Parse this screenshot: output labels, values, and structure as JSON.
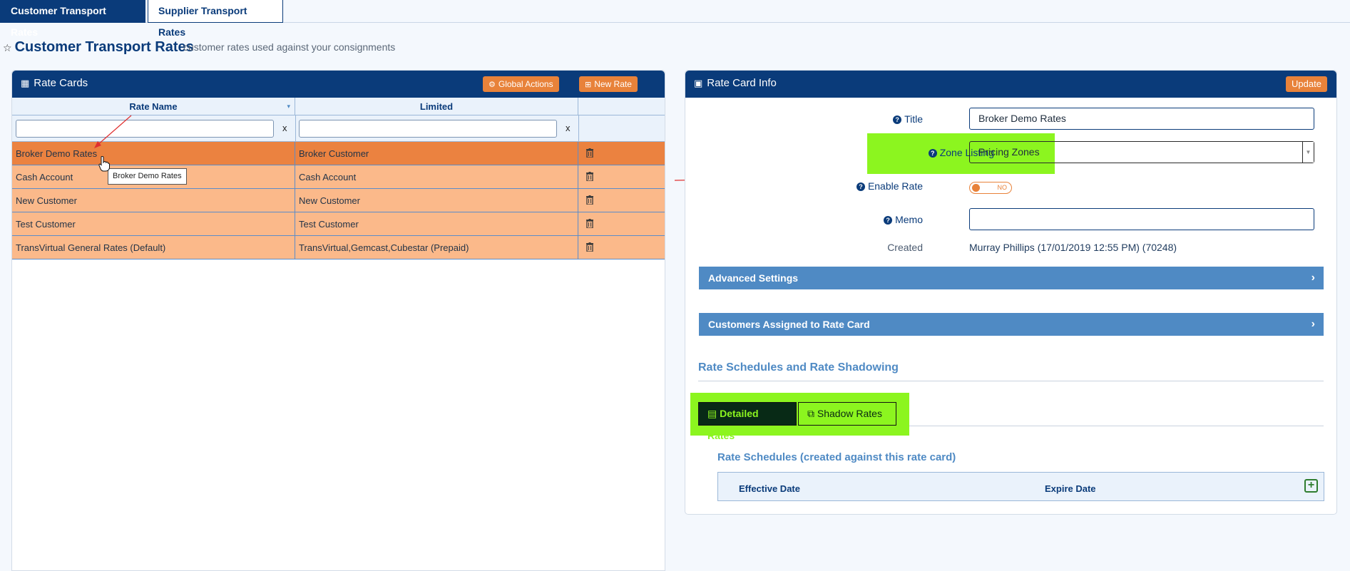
{
  "top_tabs": [
    {
      "label": "Customer Transport Rates",
      "active": true
    },
    {
      "label": "Supplier Transport Rates",
      "active": false
    }
  ],
  "page": {
    "title": "Customer Transport Rates",
    "subtitle": "customer rates used against your consignments"
  },
  "rate_cards": {
    "title": "Rate Cards",
    "global_actions_label": "Global Actions",
    "new_rate_label": "New Rate",
    "columns": [
      "Rate Name",
      "Limited"
    ],
    "filter_clear": "x",
    "rows": [
      {
        "name": "Broker Demo Rates",
        "limited": "Broker Customer",
        "selected": true
      },
      {
        "name": "Cash Account",
        "limited": "Cash Account",
        "selected": false
      },
      {
        "name": "New Customer",
        "limited": "New Customer",
        "selected": false
      },
      {
        "name": "Test Customer",
        "limited": "Test Customer",
        "selected": false
      },
      {
        "name": "TransVirtual General Rates (Default)",
        "limited": "TransVirtual,Gemcast,Cubestar (Prepaid)",
        "selected": false
      }
    ],
    "tooltip": "Broker Demo Rates"
  },
  "rate_card_info": {
    "title": "Rate Card Info",
    "update_label": "Update",
    "title_label": "Title",
    "title_value": "Broker Demo Rates",
    "zone_listing_label": "Zone Listing",
    "zone_listing_value": "Pricing Zones",
    "enable_rate_label": "Enable Rate",
    "enable_rate_state": "NO",
    "memo_label": "Memo",
    "memo_value": "",
    "created_label": "Created",
    "created_value": "Murray Phillips (17/01/2019 12:55 PM) (70248)",
    "advanced_settings_label": "Advanced Settings",
    "customers_assigned_label": "Customers Assigned to Rate Card",
    "schedules_section_title": "Rate Schedules and Rate Shadowing",
    "detailed_rates_label": "Detailed Rates",
    "shadow_rates_label": "Shadow Rates",
    "rate_schedules_title": "Rate Schedules (created against this rate card)",
    "schedule_columns": [
      "Effective Date",
      "Expire Date"
    ]
  },
  "colors": {
    "brand": "#0a3b7a",
    "accent": "#e8823a",
    "highlight": "#8cf51f",
    "row": "#fbb98a",
    "row_selected": "#eb8240"
  }
}
